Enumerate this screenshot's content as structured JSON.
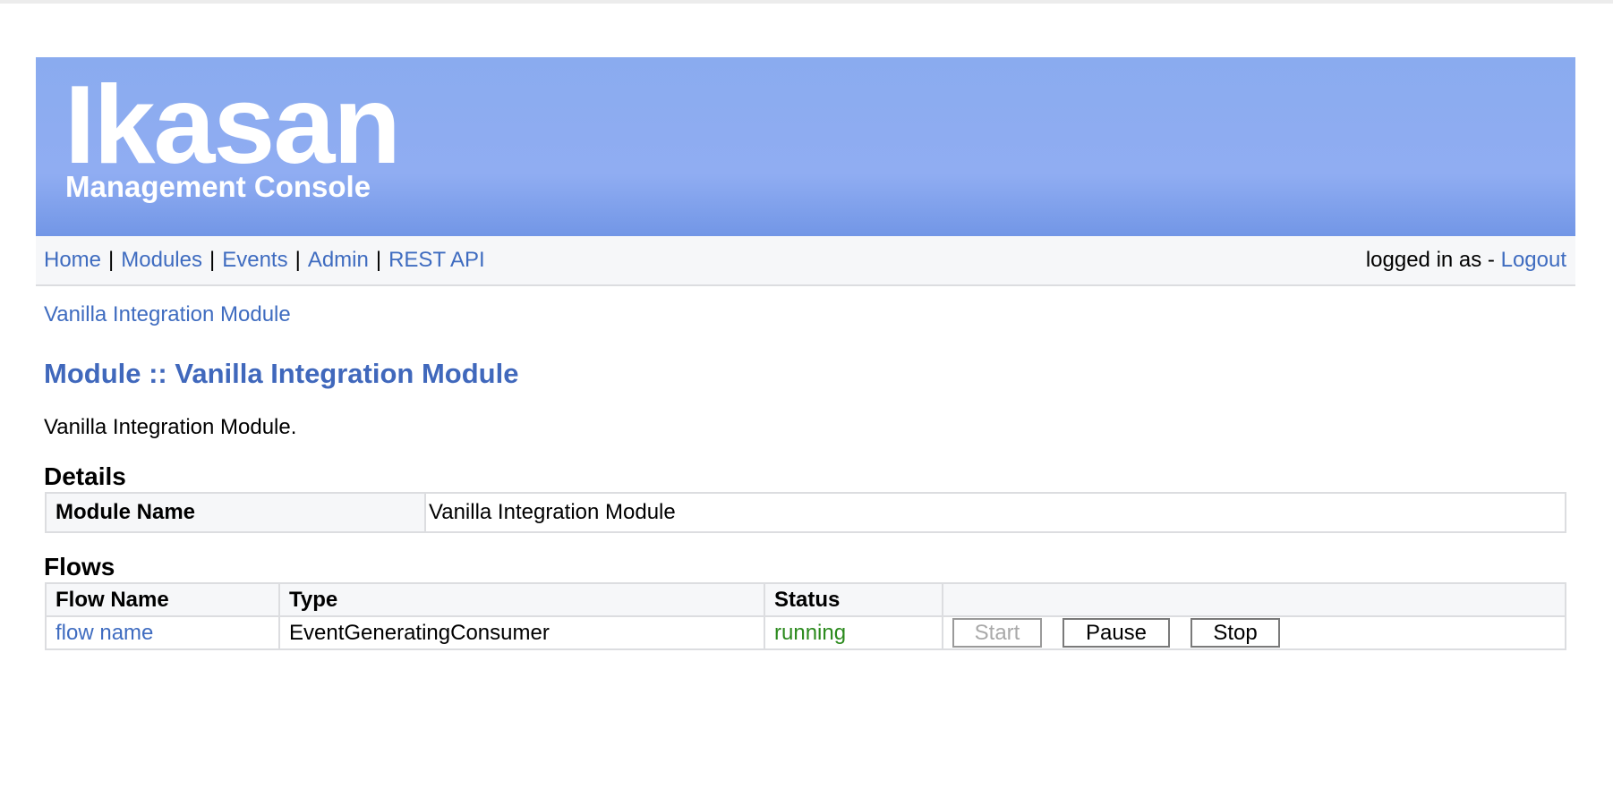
{
  "header": {
    "title": "Ikasan",
    "subtitle": "Management Console"
  },
  "nav": {
    "items": [
      {
        "label": "Home"
      },
      {
        "label": "Modules"
      },
      {
        "label": "Events"
      },
      {
        "label": "Admin"
      },
      {
        "label": "REST API"
      }
    ],
    "separator": "|",
    "logged_in_text": "logged in as -",
    "logout_label": "Logout"
  },
  "breadcrumb": "Vanilla Integration Module",
  "page_title": "Module :: Vanilla Integration Module",
  "description": "Vanilla Integration Module.",
  "details": {
    "heading": "Details",
    "rows": [
      {
        "key": "Module Name",
        "value": "Vanilla Integration Module"
      }
    ]
  },
  "flows": {
    "heading": "Flows",
    "columns": [
      "Flow Name",
      "Type",
      "Status"
    ],
    "rows": [
      {
        "name": "flow name",
        "type": "EventGeneratingConsumer",
        "status": "running",
        "actions": {
          "start": "Start",
          "pause": "Pause",
          "stop": "Stop"
        }
      }
    ]
  },
  "colors": {
    "link": "#3f6cc0",
    "title": "#4068bc",
    "status_running": "#2b8a1d",
    "banner": "#8aabef"
  }
}
